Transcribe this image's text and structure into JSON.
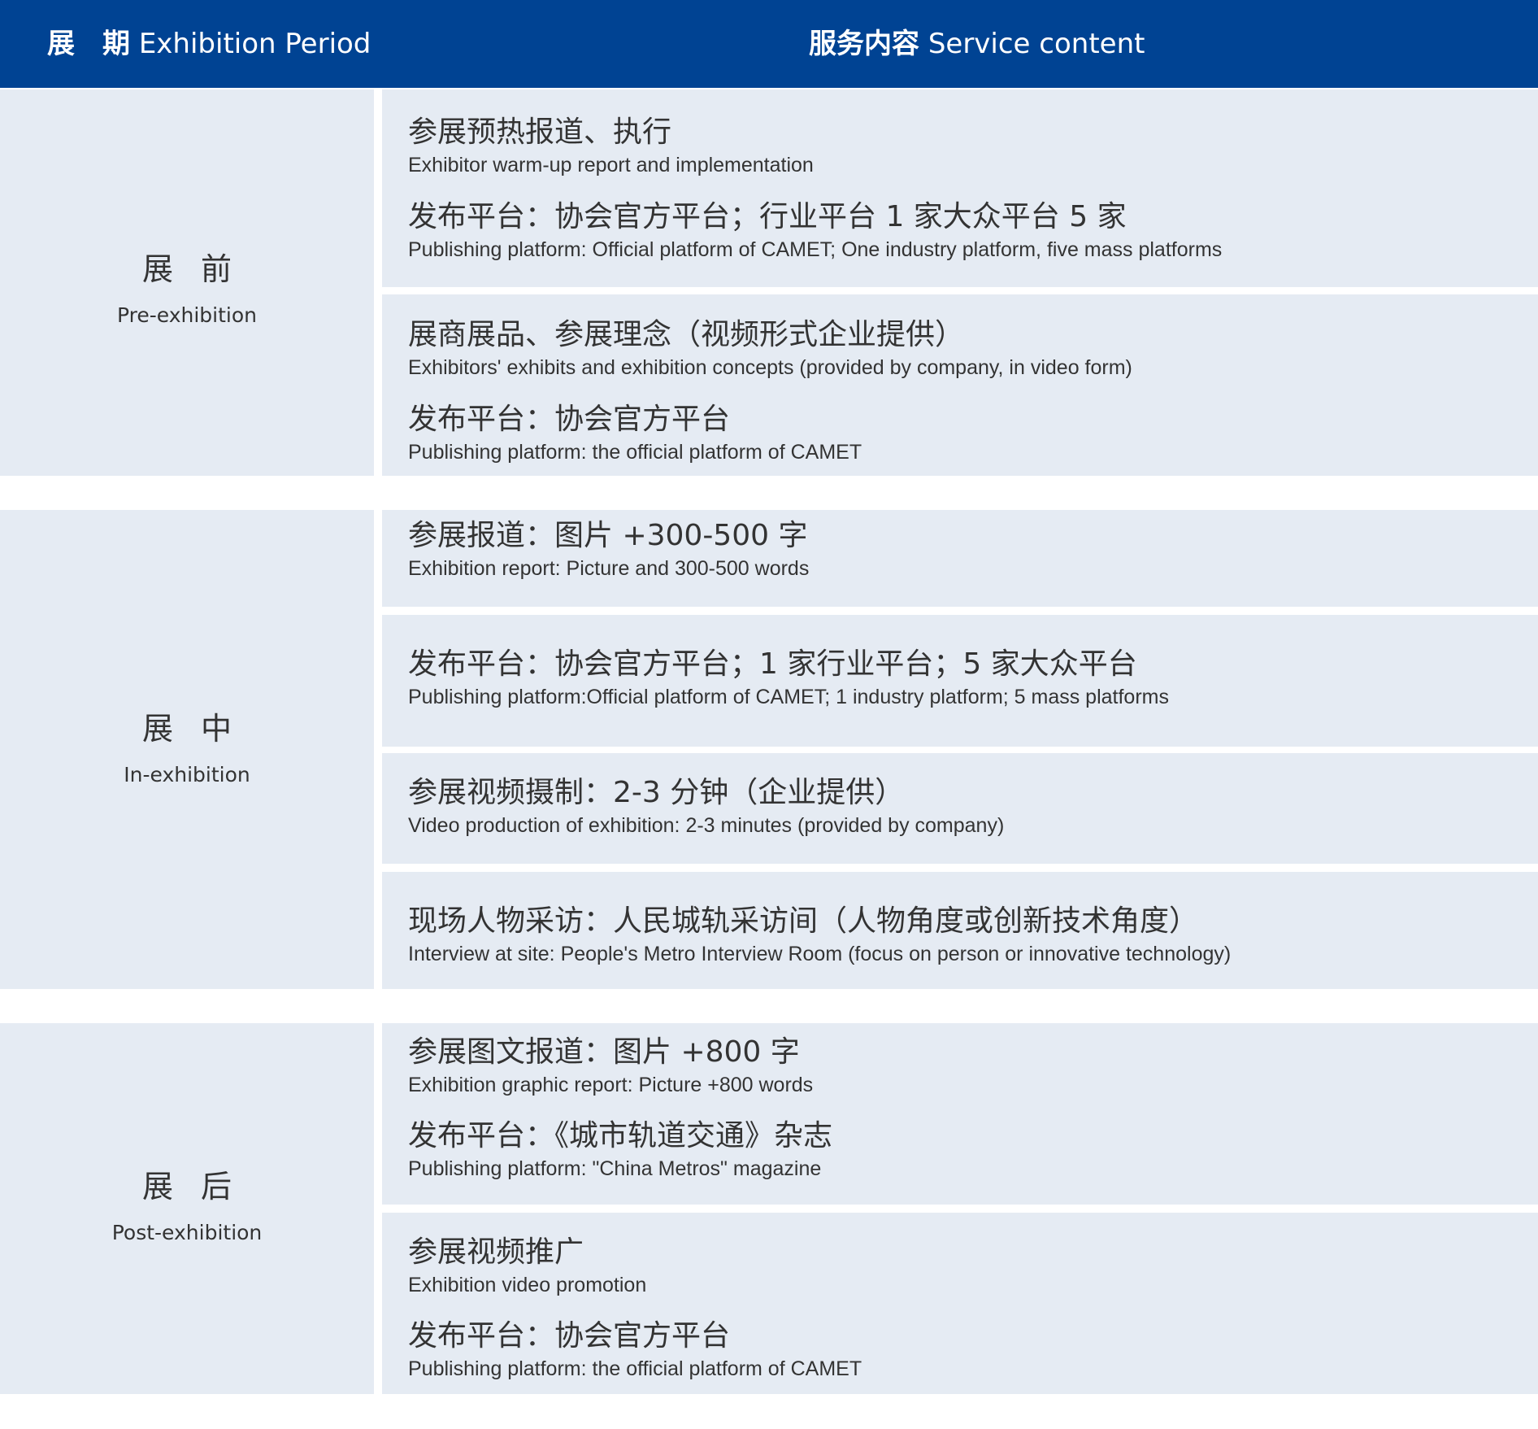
{
  "header": {
    "period_cn": "展　期",
    "period_en": "Exhibition Period",
    "service_cn": "服务内容",
    "service_en": "Service content"
  },
  "phases": [
    {
      "cn": "展前",
      "en": "Pre-exhibition",
      "cells": [
        {
          "entries": [
            {
              "cn": "参展预热报道、执行",
              "en": "Exhibitor warm-up report and implementation"
            },
            {
              "cn": "发布平台：协会官方平台；行业平台 1 家大众平台 5 家",
              "en": "Publishing platform: Official platform of CAMET; One industry platform, five mass platforms"
            }
          ]
        },
        {
          "entries": [
            {
              "cn": "展商展品、参展理念（视频形式企业提供）",
              "en": "Exhibitors' exhibits and exhibition concepts (provided by company, in video form)"
            },
            {
              "cn": "发布平台：协会官方平台",
              "en": "Publishing platform: the official platform of CAMET"
            }
          ]
        }
      ]
    },
    {
      "cn": "展中",
      "en": "In-exhibition",
      "cells": [
        {
          "entries": [
            {
              "cn": "参展报道：图片 +300-500 字",
              "en": "Exhibition report: Picture and 300-500 words"
            }
          ]
        },
        {
          "entries": [
            {
              "cn": "发布平台：协会官方平台；1 家行业平台；5 家大众平台",
              "en": "Publishing platform:Official platform of CAMET; 1 industry platform; 5 mass platforms"
            }
          ]
        },
        {
          "entries": [
            {
              "cn": "参展视频摄制：2-3 分钟（企业提供）",
              "en": "Video production of exhibition: 2-3 minutes (provided by company)"
            }
          ]
        },
        {
          "entries": [
            {
              "cn": "现场人物采访：人民城轨采访间（人物角度或创新技术角度）",
              "en": "Interview at site: People's Metro Interview Room (focus on person or innovative technology)"
            }
          ]
        }
      ]
    },
    {
      "cn": "展后",
      "en": "Post-exhibition",
      "cells": [
        {
          "entries": [
            {
              "cn": "参展图文报道：图片 +800 字",
              "en": "Exhibition graphic report: Picture +800 words"
            },
            {
              "cn": "发布平台：《城市轨道交通》杂志",
              "en": "Publishing platform: \"China Metros\" magazine"
            }
          ]
        },
        {
          "entries": [
            {
              "cn": "参展视频推广",
              "en": "Exhibition video promotion"
            },
            {
              "cn": "发布平台：协会官方平台",
              "en": "Publishing platform: the official platform of CAMET"
            }
          ]
        }
      ]
    }
  ]
}
